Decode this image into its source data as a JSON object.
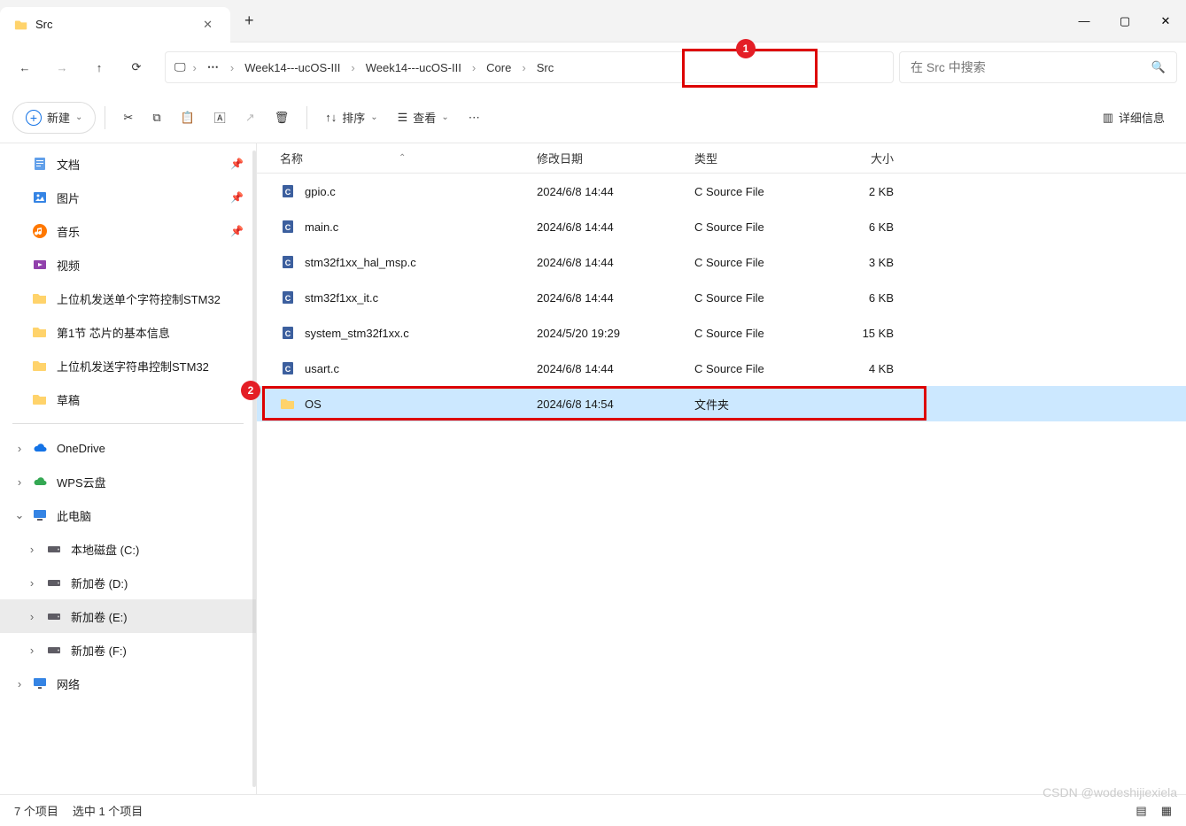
{
  "window": {
    "title": "Src"
  },
  "breadcrumb": {
    "items": [
      "Week14---ucOS-III",
      "Week14---ucOS-III",
      "Core",
      "Src"
    ]
  },
  "search": {
    "placeholder": "在 Src 中搜索"
  },
  "toolbar": {
    "new_label": "新建",
    "sort_label": "排序",
    "view_label": "查看",
    "details_label": "详细信息"
  },
  "sidebar": {
    "quick": [
      {
        "label": "文档",
        "icon": "doc",
        "pinned": true
      },
      {
        "label": "图片",
        "icon": "img",
        "pinned": true
      },
      {
        "label": "音乐",
        "icon": "music",
        "pinned": true
      },
      {
        "label": "视频",
        "icon": "video",
        "pinned": false
      },
      {
        "label": "上位机发送单个字符控制STM32",
        "icon": "folder",
        "pinned": false
      },
      {
        "label": "第1节 芯片的基本信息",
        "icon": "folder",
        "pinned": false
      },
      {
        "label": "上位机发送字符串控制STM32",
        "icon": "folder",
        "pinned": false
      },
      {
        "label": "草稿",
        "icon": "folder",
        "pinned": false
      }
    ],
    "drives_section": [
      {
        "label": "OneDrive",
        "icon": "cloud1",
        "chev": ">"
      },
      {
        "label": "WPS云盘",
        "icon": "cloud2",
        "chev": ">"
      },
      {
        "label": "此电脑",
        "icon": "pc",
        "chev": "v"
      }
    ],
    "drives": [
      {
        "label": "本地磁盘 (C:)",
        "icon": "drive"
      },
      {
        "label": "新加卷 (D:)",
        "icon": "drive"
      },
      {
        "label": "新加卷 (E:)",
        "icon": "drive",
        "selected": true
      },
      {
        "label": "新加卷 (F:)",
        "icon": "drive"
      }
    ],
    "network": {
      "label": "网络",
      "icon": "net",
      "chev": ">"
    }
  },
  "filelist": {
    "headers": {
      "name": "名称",
      "date": "修改日期",
      "type": "类型",
      "size": "大小"
    },
    "rows": [
      {
        "name": "gpio.c",
        "date": "2024/6/8 14:44",
        "type": "C Source File",
        "size": "2 KB",
        "icon": "cfile"
      },
      {
        "name": "main.c",
        "date": "2024/6/8 14:44",
        "type": "C Source File",
        "size": "6 KB",
        "icon": "cfile"
      },
      {
        "name": "stm32f1xx_hal_msp.c",
        "date": "2024/6/8 14:44",
        "type": "C Source File",
        "size": "3 KB",
        "icon": "cfile"
      },
      {
        "name": "stm32f1xx_it.c",
        "date": "2024/6/8 14:44",
        "type": "C Source File",
        "size": "6 KB",
        "icon": "cfile"
      },
      {
        "name": "system_stm32f1xx.c",
        "date": "2024/5/20 19:29",
        "type": "C Source File",
        "size": "15 KB",
        "icon": "cfile"
      },
      {
        "name": "usart.c",
        "date": "2024/6/8 14:44",
        "type": "C Source File",
        "size": "4 KB",
        "icon": "cfile"
      },
      {
        "name": "OS",
        "date": "2024/6/8 14:54",
        "type": "文件夹",
        "size": "",
        "icon": "folder",
        "selected": true
      }
    ]
  },
  "status": {
    "items": "7 个项目",
    "selected": "选中 1 个项目"
  },
  "markers": {
    "m1": "1",
    "m2": "2"
  },
  "watermark": "CSDN @wodeshijiexiela "
}
